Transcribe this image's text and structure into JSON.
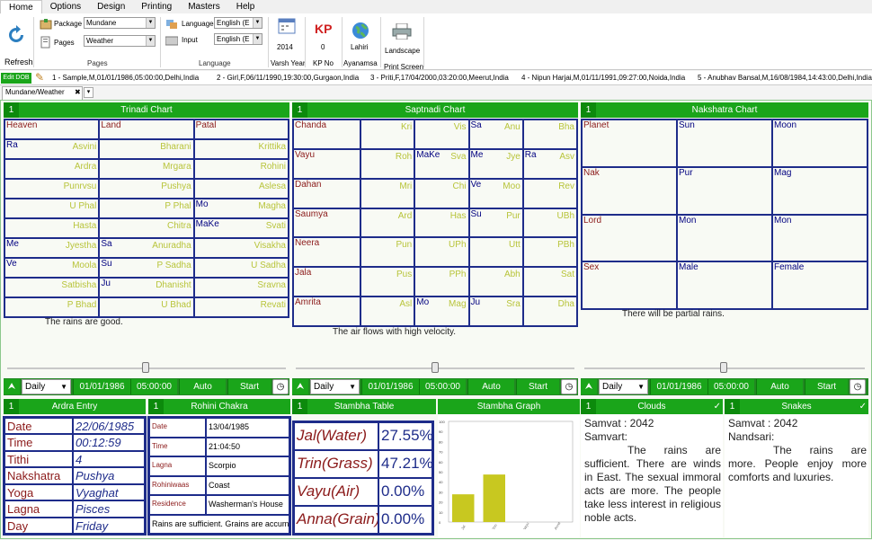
{
  "menu": [
    "Home",
    "Options",
    "Design",
    "Printing",
    "Masters",
    "Help"
  ],
  "ribbon": {
    "refresh": "Refresh",
    "package_label": "Package",
    "package_value": "Mundane",
    "pages_label": "Pages",
    "pages_value": "Weather",
    "pages_group": "Pages",
    "language_label": "Language",
    "language_value": "English (E",
    "input_label": "Input",
    "input_value": "English (E",
    "language_group": "Language",
    "varsh_value": "2014",
    "varsh_label": "Varsh Year",
    "kp_icon": "KP",
    "kp_value": "0",
    "kp_label": "KP No",
    "ayan_value": "Lahiri",
    "ayan_label": "Ayanamsa",
    "print_value": "Landscape",
    "print_label": "Print Screen"
  },
  "dobbar": {
    "edit": "Edit DOB",
    "persons": [
      "1 - Sample,M,01/01/1986,05:00:00,Delhi,India",
      "2 - Girl,F,06/11/1990,19:30:00,Gurgaon,India",
      "3 - Priti,F,17/04/2000,03:20:00,Meerut,India",
      "4 - Nipun Harjai,M,01/11/1991,09:27:00,Noida,India",
      "5 - Anubhav Bansal,M,16/08/1984,14:43:00,Delhi,India"
    ]
  },
  "tab": {
    "label": "Mundane/Weather",
    "close": "✖",
    "add": "▾"
  },
  "trinadi": {
    "num": "1",
    "title": "Trinadi Chart",
    "headers": [
      "Heaven",
      "Land",
      "Patal"
    ],
    "rows": [
      [
        {
          "l": "Ra",
          "r": "Asvini"
        },
        {
          "l": "",
          "r": "Bharani"
        },
        {
          "l": "",
          "r": "Krittika"
        }
      ],
      [
        {
          "l": "",
          "r": "Ardra"
        },
        {
          "l": "",
          "r": "Mrgara"
        },
        {
          "l": "",
          "r": "Rohini"
        }
      ],
      [
        {
          "l": "",
          "r": "Punrvsu"
        },
        {
          "l": "",
          "r": "Pushya"
        },
        {
          "l": "",
          "r": "Aslesa"
        }
      ],
      [
        {
          "l": "",
          "r": "U Phal"
        },
        {
          "l": "",
          "r": "P Phal"
        },
        {
          "l": "Mo",
          "r": "Magha"
        }
      ],
      [
        {
          "l": "",
          "r": "Hasta"
        },
        {
          "l": "",
          "r": "Chitra"
        },
        {
          "l": "MaKe",
          "r": "Svati"
        }
      ],
      [
        {
          "l": "Me",
          "r": "Jyestha"
        },
        {
          "l": "Sa",
          "r": "Anuradha"
        },
        {
          "l": "",
          "r": "Visakha"
        }
      ],
      [
        {
          "l": "Ve",
          "r": "Moola"
        },
        {
          "l": "Su",
          "r": "P Sadha"
        },
        {
          "l": "",
          "r": "U Sadha"
        }
      ],
      [
        {
          "l": "",
          "r": "Satbisha"
        },
        {
          "l": "Ju",
          "r": "Dhanisht"
        },
        {
          "l": "",
          "r": "Sravna"
        }
      ],
      [
        {
          "l": "",
          "r": "P Bhad"
        },
        {
          "l": "",
          "r": "U Bhad"
        },
        {
          "l": "",
          "r": "Revati"
        }
      ]
    ],
    "note": "The rains are good."
  },
  "saptnadi": {
    "num": "1",
    "title": "Saptnadi Chart",
    "rows": [
      {
        "name": "Chanda",
        "cells": [
          {
            "l": "",
            "r": "Kri"
          },
          {
            "l": "",
            "r": "Vis"
          },
          {
            "l": "Sa",
            "r": "Anu"
          },
          {
            "l": "",
            "r": "Bha"
          }
        ]
      },
      {
        "name": "Vayu",
        "cells": [
          {
            "l": "",
            "r": "Roh"
          },
          {
            "l": "MaKe",
            "r": "Sva"
          },
          {
            "l": "Me",
            "r": "Jye"
          },
          {
            "l": "Ra",
            "r": "Asv"
          }
        ]
      },
      {
        "name": "Dahan",
        "cells": [
          {
            "l": "",
            "r": "Mri"
          },
          {
            "l": "",
            "r": "Chi"
          },
          {
            "l": "Ve",
            "r": "Moo"
          },
          {
            "l": "",
            "r": "Rev"
          }
        ]
      },
      {
        "name": "Saumya",
        "cells": [
          {
            "l": "",
            "r": "Ard"
          },
          {
            "l": "",
            "r": "Has"
          },
          {
            "l": "Su",
            "r": "Pur"
          },
          {
            "l": "",
            "r": "UBh"
          }
        ]
      },
      {
        "name": "Neera",
        "cells": [
          {
            "l": "",
            "r": "Pun"
          },
          {
            "l": "",
            "r": "UPh"
          },
          {
            "l": "",
            "r": "Utt"
          },
          {
            "l": "",
            "r": "PBh"
          }
        ]
      },
      {
        "name": "Jala",
        "cells": [
          {
            "l": "",
            "r": "Pus"
          },
          {
            "l": "",
            "r": "PPh"
          },
          {
            "l": "",
            "r": "Abh"
          },
          {
            "l": "",
            "r": "Sat"
          }
        ]
      },
      {
        "name": "Amrita",
        "cells": [
          {
            "l": "",
            "r": "Asl"
          },
          {
            "l": "Mo",
            "r": "Mag"
          },
          {
            "l": "Ju",
            "r": "Sra"
          },
          {
            "l": "",
            "r": "Dha"
          }
        ]
      }
    ],
    "note": "The air flows with high velocity."
  },
  "nakshatra": {
    "num": "1",
    "title": "Nakshatra Chart",
    "rows": [
      [
        "Planet",
        "Sun",
        "Moon"
      ],
      [
        "Nak",
        "Pur",
        "Mag"
      ],
      [
        "Lord",
        "Mon",
        "Mon"
      ],
      [
        "Sex",
        "Male",
        "Female"
      ]
    ],
    "note": "There will be partial rains."
  },
  "controls": {
    "mode": "Daily",
    "date": "01/01/1986",
    "time": "05:00:00",
    "auto": "Auto",
    "start": "Start"
  },
  "ardra": {
    "num": "1",
    "title": "Ardra Entry",
    "rows": [
      [
        "Date",
        "22/06/1985"
      ],
      [
        "Time",
        "00:12:59"
      ],
      [
        "Tithi",
        "4"
      ],
      [
        "Nakshatra",
        "Pushya"
      ],
      [
        "Yoga",
        "Vyaghat"
      ],
      [
        "Lagna",
        "Pisces"
      ],
      [
        "Day",
        "Friday"
      ]
    ]
  },
  "rohini": {
    "num": "1",
    "title": "Rohini Chakra",
    "rows": [
      [
        "Date",
        "13/04/1985"
      ],
      [
        "Time",
        "21:04:50"
      ],
      [
        "Lagna",
        "Scorpio"
      ],
      [
        "Rohiniwaas",
        "Coast"
      ],
      [
        "Residence",
        "Washerman's House"
      ]
    ],
    "note": "Rains are sufficient. Grains are accumulated."
  },
  "stambha": {
    "num": "1",
    "title": "Stambha Table",
    "rows": [
      [
        "Jal(Water)",
        "27.55%"
      ],
      [
        "Trin(Grass)",
        "47.21%"
      ],
      [
        "Vayu(Air)",
        "0.00%"
      ],
      [
        "Anna(Grain)",
        "0.00%"
      ]
    ]
  },
  "stambha_graph": {
    "title": "Stambha Graph"
  },
  "chart_data": {
    "type": "bar",
    "categories": [
      "Jal",
      "Trin",
      "Vayu",
      "Anna"
    ],
    "values": [
      27.55,
      47.21,
      0,
      0
    ],
    "ylim": [
      0,
      100
    ],
    "yticks": [
      "100",
      "90",
      "80",
      "70",
      "60",
      "50",
      "40",
      "30",
      "20",
      "10",
      "0"
    ],
    "title": "",
    "xlabel": "",
    "ylabel": "",
    "bar_color": "#c8c820"
  },
  "clouds": {
    "num": "1",
    "title": "Clouds",
    "check": "✓",
    "samvat": "Samvat : 2042",
    "label": "Samvart:",
    "text": "The rains are sufficient. There are winds in East. The sexual immoral acts are more. The people take less interest in religious noble acts."
  },
  "snakes": {
    "num": "1",
    "title": "Snakes",
    "check": "✓",
    "samvat": "Samvat : 2042",
    "label": "Nandsari:",
    "text": "The rains are more. People enjoy more comforts and luxuries."
  }
}
